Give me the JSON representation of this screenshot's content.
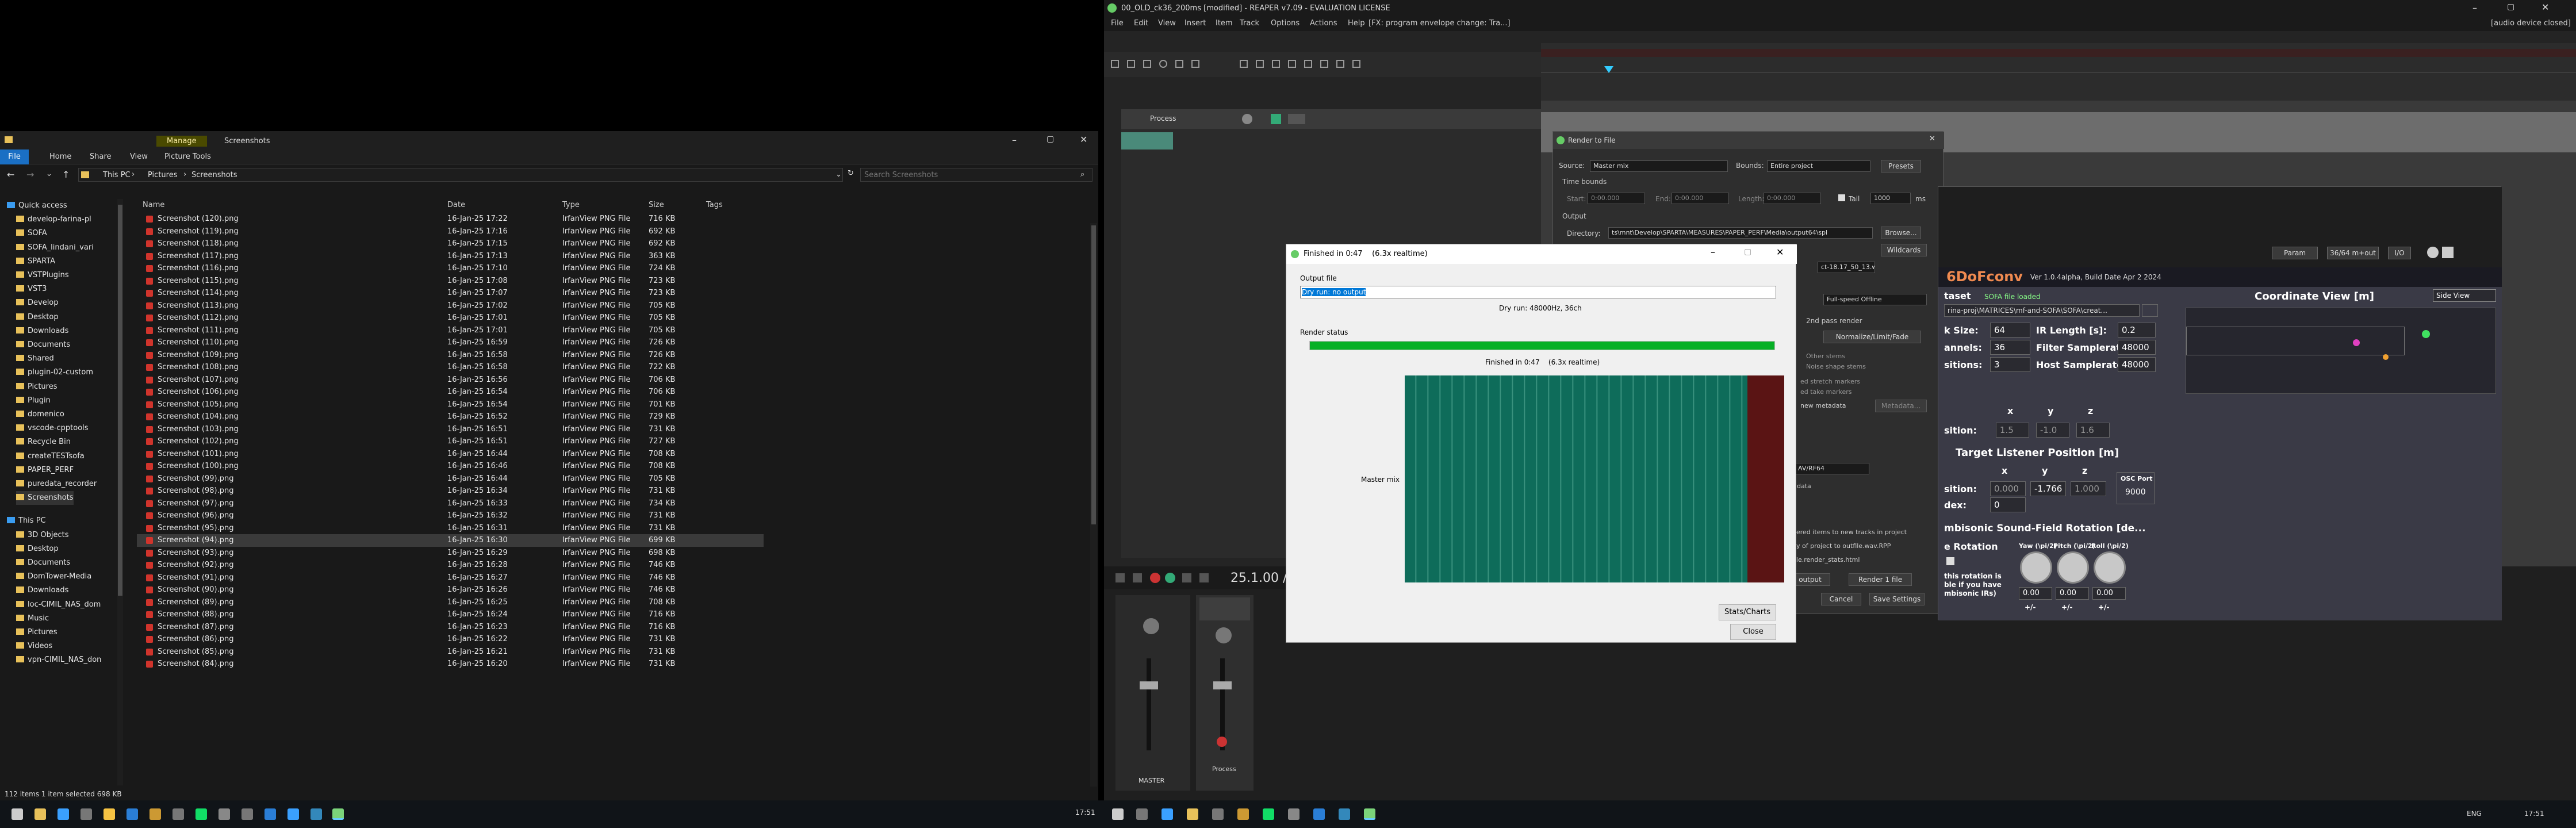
{
  "explorer": {
    "tabs": [
      "Manage",
      "Screenshots"
    ],
    "ribbon": [
      "File",
      "Home",
      "Share",
      "View",
      "Picture Tools"
    ],
    "breadcrumb": [
      "This PC",
      "Pictures",
      "Screenshots"
    ],
    "search_placeholder": "Search Screenshots",
    "columns": [
      "Name",
      "Date",
      "Type",
      "Size",
      "Tags"
    ],
    "sidebar": [
      "Quick access",
      "develop-farina-pl",
      "SOFA",
      "SOFA_lindani_vari",
      "SPARTA",
      "VSTPlugins",
      "VST3",
      "Develop",
      "Desktop",
      "Downloads",
      "Documents",
      "Shared",
      "plugin-02-custom",
      "Pictures",
      "Plugin",
      "domenico",
      "vscode-cpptools",
      "Recycle Bin",
      "createTESTsofa",
      "PAPER_PERF",
      "puredata_recorder",
      "Screenshots",
      "This PC",
      "3D Objects",
      "Desktop",
      "Documents",
      "DomTower-Media",
      "Downloads",
      "loc-CIMIL_NAS_dom",
      "Music",
      "Pictures",
      "Videos",
      "vpn-CIMIL_NAS_don"
    ],
    "files": [
      [
        "Screenshot (120).png",
        "16-Jan-25 17:22",
        "IrfanView PNG File",
        "716 KB"
      ],
      [
        "Screenshot (119).png",
        "16-Jan-25 17:16",
        "IrfanView PNG File",
        "692 KB"
      ],
      [
        "Screenshot (118).png",
        "16-Jan-25 17:15",
        "IrfanView PNG File",
        "692 KB"
      ],
      [
        "Screenshot (117).png",
        "16-Jan-25 17:13",
        "IrfanView PNG File",
        "363 KB"
      ],
      [
        "Screenshot (116).png",
        "16-Jan-25 17:10",
        "IrfanView PNG File",
        "724 KB"
      ],
      [
        "Screenshot (115).png",
        "16-Jan-25 17:08",
        "IrfanView PNG File",
        "723 KB"
      ],
      [
        "Screenshot (114).png",
        "16-Jan-25 17:07",
        "IrfanView PNG File",
        "723 KB"
      ],
      [
        "Screenshot (113).png",
        "16-Jan-25 17:02",
        "IrfanView PNG File",
        "705 KB"
      ],
      [
        "Screenshot (112).png",
        "16-Jan-25 17:01",
        "IrfanView PNG File",
        "705 KB"
      ],
      [
        "Screenshot (111).png",
        "16-Jan-25 17:01",
        "IrfanView PNG File",
        "705 KB"
      ],
      [
        "Screenshot (110).png",
        "16-Jan-25 16:59",
        "IrfanView PNG File",
        "726 KB"
      ],
      [
        "Screenshot (109).png",
        "16-Jan-25 16:58",
        "IrfanView PNG File",
        "726 KB"
      ],
      [
        "Screenshot (108).png",
        "16-Jan-25 16:58",
        "IrfanView PNG File",
        "722 KB"
      ],
      [
        "Screenshot (107).png",
        "16-Jan-25 16:56",
        "IrfanView PNG File",
        "706 KB"
      ],
      [
        "Screenshot (106).png",
        "16-Jan-25 16:54",
        "IrfanView PNG File",
        "706 KB"
      ],
      [
        "Screenshot (105).png",
        "16-Jan-25 16:54",
        "IrfanView PNG File",
        "701 KB"
      ],
      [
        "Screenshot (104).png",
        "16-Jan-25 16:52",
        "IrfanView PNG File",
        "729 KB"
      ],
      [
        "Screenshot (103).png",
        "16-Jan-25 16:51",
        "IrfanView PNG File",
        "731 KB"
      ],
      [
        "Screenshot (102).png",
        "16-Jan-25 16:51",
        "IrfanView PNG File",
        "727 KB"
      ],
      [
        "Screenshot (101).png",
        "16-Jan-25 16:44",
        "IrfanView PNG File",
        "708 KB"
      ],
      [
        "Screenshot (100).png",
        "16-Jan-25 16:46",
        "IrfanView PNG File",
        "708 KB"
      ],
      [
        "Screenshot (99).png",
        "16-Jan-25 16:44",
        "IrfanView PNG File",
        "705 KB"
      ],
      [
        "Screenshot (98).png",
        "16-Jan-25 16:34",
        "IrfanView PNG File",
        "731 KB"
      ],
      [
        "Screenshot (97).png",
        "16-Jan-25 16:33",
        "IrfanView PNG File",
        "734 KB"
      ],
      [
        "Screenshot (96).png",
        "16-Jan-25 16:32",
        "IrfanView PNG File",
        "731 KB"
      ],
      [
        "Screenshot (95).png",
        "16-Jan-25 16:31",
        "IrfanView PNG File",
        "731 KB"
      ],
      [
        "Screenshot (94).png",
        "16-Jan-25 16:30",
        "IrfanView PNG File",
        "699 KB"
      ],
      [
        "Screenshot (93).png",
        "16-Jan-25 16:29",
        "IrfanView PNG File",
        "698 KB"
      ],
      [
        "Screenshot (92).png",
        "16-Jan-25 16:28",
        "IrfanView PNG File",
        "746 KB"
      ],
      [
        "Screenshot (91).png",
        "16-Jan-25 16:27",
        "IrfanView PNG File",
        "746 KB"
      ],
      [
        "Screenshot (90).png",
        "16-Jan-25 16:26",
        "IrfanView PNG File",
        "746 KB"
      ],
      [
        "Screenshot (89).png",
        "16-Jan-25 16:25",
        "IrfanView PNG File",
        "708 KB"
      ],
      [
        "Screenshot (88).png",
        "16-Jan-25 16:24",
        "IrfanView PNG File",
        "716 KB"
      ],
      [
        "Screenshot (87).png",
        "16-Jan-25 16:23",
        "IrfanView PNG File",
        "716 KB"
      ],
      [
        "Screenshot (86).png",
        "16-Jan-25 16:22",
        "IrfanView PNG File",
        "731 KB"
      ],
      [
        "Screenshot (85).png",
        "16-Jan-25 16:21",
        "IrfanView PNG File",
        "731 KB"
      ],
      [
        "Screenshot (84).png",
        "16-Jan-25 16:20",
        "IrfanView PNG File",
        "731 KB"
      ]
    ],
    "selected_index": 26,
    "status": "112 items    1 item selected  698 KB"
  },
  "reaper": {
    "title": "00_OLD_ck36_200ms [modified] - REAPER v7.09 - EVALUATION LICENSE",
    "audio_status": "[audio device closed]",
    "menu": [
      "File",
      "Edit",
      "View",
      "Insert",
      "Item",
      "Track",
      "Options",
      "Actions",
      "Help",
      "[FX: program envelope change: Tra...]"
    ],
    "track_name": "Process",
    "time": "25.1.00 /",
    "master_label": "MASTER",
    "mixer_track": "Process"
  },
  "render": {
    "title": "Render to File",
    "source_label": "Source:",
    "source": "Master mix",
    "bounds_label": "Bounds:",
    "bounds": "Entire project",
    "presets": "Presets",
    "time_bounds": "Time bounds",
    "start_label": "Start:",
    "start": "0:00.000",
    "end_label": "End:",
    "end": "0:00.000",
    "length_label": "Length:",
    "length": "0:00.000",
    "tail_label": "Tail",
    "tail": "1000",
    "tail_unit": "ms",
    "output_label": "Output",
    "directory_label": "Directory:",
    "directory": "ts\\mnt\\Develop\\SPARTA\\MEASURES\\PAPER_PERF\\Media\\output64\\spl",
    "browse": "Browse...",
    "wildcards": "Wildcards",
    "file_name": "ct-18.17_50_13.wav",
    "fullspeed": "Full-speed Offline",
    "two_pass": "2nd pass render",
    "normalize": "Normalize/Limit/Fade",
    "other_stems": "Other stems",
    "noise_shape": "Noise shape stems",
    "stretch_markers": "ed stretch markers",
    "take_markers": "ed take markers",
    "metadata": "new metadata",
    "metadata_btn": "Metadata...",
    "codec": "AV/RF64",
    "data": "data",
    "add_items": "dered items to new tracks in project",
    "copy_project": "py of project to outfile.wav.RPP",
    "render_stats": "file.render_stats.html",
    "output_btn": "output",
    "render_btn": "Render 1 file",
    "cancel": "Cancel",
    "save_settings": "Save Settings"
  },
  "plugin": {
    "name": "6DoFconv",
    "version": "Ver 1.0.4alpha, Build Date Apr 2 2024",
    "param_btn": "Param",
    "preset": "36/64 m+out",
    "io": "I/O",
    "dataset_label": "taset",
    "sofa_status": "SOFA file loaded",
    "sofa_path": "rina-proj\\MATRICES\\mf-and-SOFA\\SOFA\\creat...",
    "block_size_label": "k Size:",
    "block_size": "64",
    "ir_length_label": "IR Length [s]:",
    "ir_length": "0.2",
    "channels_label": "annels:",
    "channels": "36",
    "filter_sr_label": "Filter Samplerate:",
    "filter_sr": "48000",
    "positions_label": "sitions:",
    "positions": "3",
    "host_sr_label": "Host Samplerate:",
    "host_sr": "48000",
    "coord_title": "Coordinate View [m]",
    "side_view": "Side View",
    "axis_x": "x",
    "axis_y": "y",
    "axis_z": "z",
    "pos_label": "sition:",
    "pos_x": "1.5",
    "pos_y": "-1.0",
    "pos_z": "1.6",
    "target_title": "Target Listener Position [m]",
    "target_pos_label": "sition:",
    "target_x": "0.000",
    "target_y": "-1.766",
    "target_z": "1.000",
    "osc_label": "OSC Port",
    "osc_port": "9000",
    "index_label": "dex:",
    "index": "0",
    "rotation_title": "mbisonic Sound-Field Rotation [de...",
    "rot_label": "e Rotation",
    "yaw_label": "Yaw (\\pi/2)",
    "pitch_label": "Pitch (\\pi/2)",
    "roll_label": "Roll (\\pi/2)",
    "yaw": "0.00",
    "pitch": "0.00",
    "roll": "0.00",
    "note": "this rotation is\nble if you have\nmbisonic IRs)",
    "plusminus": "+/-"
  },
  "finished": {
    "title": "Finished in 0:47    (6.3x realtime)",
    "output_file_label": "Output file",
    "output_file": "Dry run: no output",
    "dry_info": "Dry run: 48000Hz, 36ch",
    "render_status_label": "Render status",
    "progress": 1.0,
    "status_text": "Finished in 0:47    (6.3x realtime)",
    "master_mix": "Master mix",
    "stats_btn": "Stats/Charts",
    "close_btn": "Close"
  },
  "taskbar": {
    "clock_left": "17:51",
    "clock_right": "17:51",
    "lang": "ENG"
  }
}
